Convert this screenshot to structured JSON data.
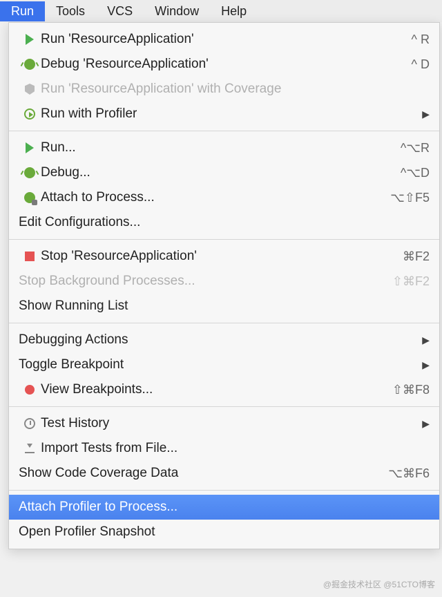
{
  "menubar": {
    "items": [
      {
        "label": "Run",
        "active": true
      },
      {
        "label": "Tools",
        "active": false
      },
      {
        "label": "VCS",
        "active": false
      },
      {
        "label": "Window",
        "active": false
      },
      {
        "label": "Help",
        "active": false
      }
    ]
  },
  "dropdown": {
    "groups": [
      [
        {
          "icon": "play-icon",
          "label": "Run 'ResourceApplication'",
          "shortcut": "^ R"
        },
        {
          "icon": "bug-icon",
          "label": "Debug 'ResourceApplication'",
          "shortcut": "^ D"
        },
        {
          "icon": "coverage-icon",
          "label": "Run 'ResourceApplication' with Coverage",
          "disabled": true
        },
        {
          "icon": "profiler-icon",
          "label": "Run with Profiler",
          "submenu": true
        }
      ],
      [
        {
          "icon": "play-icon",
          "label": "Run...",
          "shortcut": "^⌥R"
        },
        {
          "icon": "bug-icon",
          "label": "Debug...",
          "shortcut": "^⌥D"
        },
        {
          "icon": "bug-attach-icon",
          "label": "Attach to Process...",
          "shortcut": "⌥⇧F5"
        },
        {
          "label": "Edit Configurations...",
          "noindent": true
        }
      ],
      [
        {
          "icon": "stop-icon",
          "label": "Stop 'ResourceApplication'",
          "shortcut": "⌘F2"
        },
        {
          "label": "Stop Background Processes...",
          "shortcut": "⇧⌘F2",
          "disabled": true,
          "noindent": true
        },
        {
          "label": "Show Running List",
          "noindent": true
        }
      ],
      [
        {
          "label": "Debugging Actions",
          "submenu": true,
          "noindent": true
        },
        {
          "label": "Toggle Breakpoint",
          "submenu": true,
          "noindent": true
        },
        {
          "icon": "breakpoint-icon",
          "label": "View Breakpoints...",
          "shortcut": "⇧⌘F8"
        }
      ],
      [
        {
          "icon": "clock-icon",
          "label": "Test History",
          "submenu": true
        },
        {
          "icon": "import-icon",
          "label": "Import Tests from File..."
        },
        {
          "label": "Show Code Coverage Data",
          "shortcut": "⌥⌘F6",
          "noindent": true
        }
      ],
      [
        {
          "label": "Attach Profiler to Process...",
          "highlighted": true,
          "noindent": true
        },
        {
          "label": "Open Profiler Snapshot",
          "noindent": true
        }
      ]
    ]
  },
  "watermark": "@掘金技术社区  @51CTO博客"
}
